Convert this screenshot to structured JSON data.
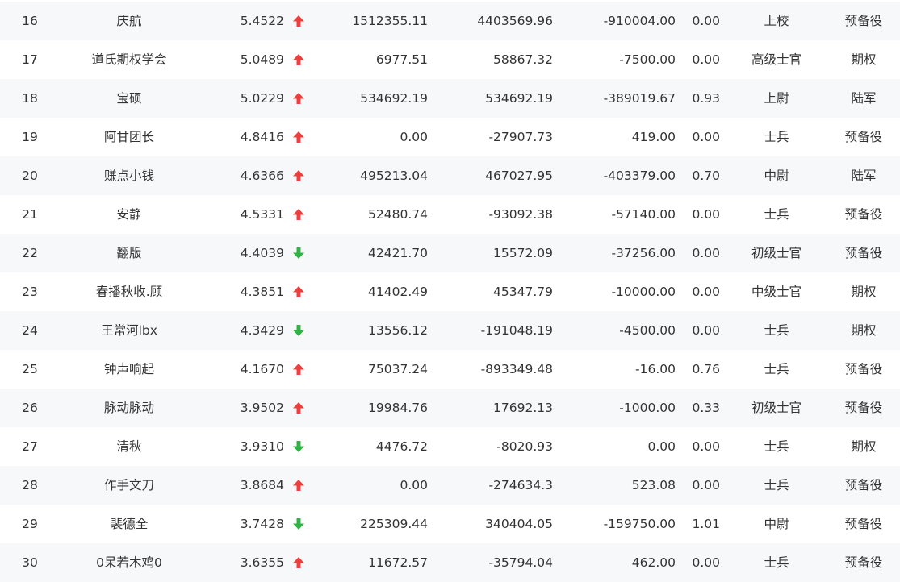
{
  "colors": {
    "up": "#f03e3e",
    "down": "#2fb344",
    "text": "#333333",
    "row_odd_bg": "#f7f8fa",
    "row_even_bg": "#ffffff"
  },
  "rows": [
    {
      "rank": "16",
      "name": "庆航",
      "score": "5.4522",
      "trend": "up",
      "v1": "1512355.11",
      "v2": "4403569.96",
      "v3": "-910004.00",
      "ratio": "0.00",
      "rank_name": "上校",
      "group": "预备役"
    },
    {
      "rank": "17",
      "name": "道氏期权学会",
      "score": "5.0489",
      "trend": "up",
      "v1": "6977.51",
      "v2": "58867.32",
      "v3": "-7500.00",
      "ratio": "0.00",
      "rank_name": "高级士官",
      "group": "期权"
    },
    {
      "rank": "18",
      "name": "宝硕",
      "score": "5.0229",
      "trend": "up",
      "v1": "534692.19",
      "v2": "534692.19",
      "v3": "-389019.67",
      "ratio": "0.93",
      "rank_name": "上尉",
      "group": "陆军"
    },
    {
      "rank": "19",
      "name": "阿甘团长",
      "score": "4.8416",
      "trend": "up",
      "v1": "0.00",
      "v2": "-27907.73",
      "v3": "419.00",
      "ratio": "0.00",
      "rank_name": "士兵",
      "group": "预备役"
    },
    {
      "rank": "20",
      "name": "赚点小钱",
      "score": "4.6366",
      "trend": "up",
      "v1": "495213.04",
      "v2": "467027.95",
      "v3": "-403379.00",
      "ratio": "0.70",
      "rank_name": "中尉",
      "group": "陆军"
    },
    {
      "rank": "21",
      "name": "安静",
      "score": "4.5331",
      "trend": "up",
      "v1": "52480.74",
      "v2": "-93092.38",
      "v3": "-57140.00",
      "ratio": "0.00",
      "rank_name": "士兵",
      "group": "预备役"
    },
    {
      "rank": "22",
      "name": "翻版",
      "score": "4.4039",
      "trend": "down",
      "v1": "42421.70",
      "v2": "15572.09",
      "v3": "-37256.00",
      "ratio": "0.00",
      "rank_name": "初级士官",
      "group": "预备役"
    },
    {
      "rank": "23",
      "name": "春播秋收.顾",
      "score": "4.3851",
      "trend": "up",
      "v1": "41402.49",
      "v2": "45347.79",
      "v3": "-10000.00",
      "ratio": "0.00",
      "rank_name": "中级士官",
      "group": "期权"
    },
    {
      "rank": "24",
      "name": "王常河lbx",
      "score": "4.3429",
      "trend": "down",
      "v1": "13556.12",
      "v2": "-191048.19",
      "v3": "-4500.00",
      "ratio": "0.00",
      "rank_name": "士兵",
      "group": "期权"
    },
    {
      "rank": "25",
      "name": "钟声响起",
      "score": "4.1670",
      "trend": "up",
      "v1": "75037.24",
      "v2": "-893349.48",
      "v3": "-16.00",
      "ratio": "0.76",
      "rank_name": "士兵",
      "group": "预备役"
    },
    {
      "rank": "26",
      "name": "脉动脉动",
      "score": "3.9502",
      "trend": "up",
      "v1": "19984.76",
      "v2": "17692.13",
      "v3": "-1000.00",
      "ratio": "0.33",
      "rank_name": "初级士官",
      "group": "预备役"
    },
    {
      "rank": "27",
      "name": "清秋",
      "score": "3.9310",
      "trend": "down",
      "v1": "4476.72",
      "v2": "-8020.93",
      "v3": "0.00",
      "ratio": "0.00",
      "rank_name": "士兵",
      "group": "期权"
    },
    {
      "rank": "28",
      "name": "作手文刀",
      "score": "3.8684",
      "trend": "up",
      "v1": "0.00",
      "v2": "-274634.3",
      "v3": "523.08",
      "ratio": "0.00",
      "rank_name": "士兵",
      "group": "预备役"
    },
    {
      "rank": "29",
      "name": "裴德全",
      "score": "3.7428",
      "trend": "down",
      "v1": "225309.44",
      "v2": "340404.05",
      "v3": "-159750.00",
      "ratio": "1.01",
      "rank_name": "中尉",
      "group": "预备役"
    },
    {
      "rank": "30",
      "name": "0呆若木鸡0",
      "score": "3.6355",
      "trend": "up",
      "v1": "11672.57",
      "v2": "-35794.04",
      "v3": "462.00",
      "ratio": "0.00",
      "rank_name": "士兵",
      "group": "预备役"
    }
  ]
}
